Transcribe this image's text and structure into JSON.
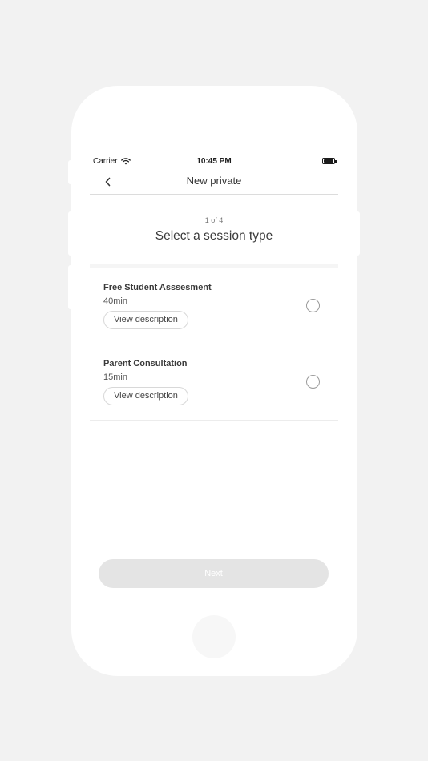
{
  "status_bar": {
    "carrier": "Carrier",
    "time": "10:45 PM",
    "wifi_icon": "wifi-icon",
    "battery_icon": "battery-icon"
  },
  "nav": {
    "back_icon": "chevron-left-icon",
    "title": "New private"
  },
  "step": {
    "label": "1 of 4"
  },
  "heading": "Select a session type",
  "sessions": [
    {
      "name": "Free Student Asssesment",
      "duration": "40min",
      "button_label": "View description",
      "selected": false
    },
    {
      "name": "Parent Consultation",
      "duration": "15min",
      "button_label": "View description",
      "selected": false
    }
  ],
  "footer": {
    "next_label": "Next",
    "next_enabled": false
  },
  "colors": {
    "background": "#f2f2f2",
    "device": "#ffffff",
    "text_primary": "#3a3a3a",
    "radio_border": "#9a9a9a",
    "disabled_button": "#e4e4e4"
  }
}
